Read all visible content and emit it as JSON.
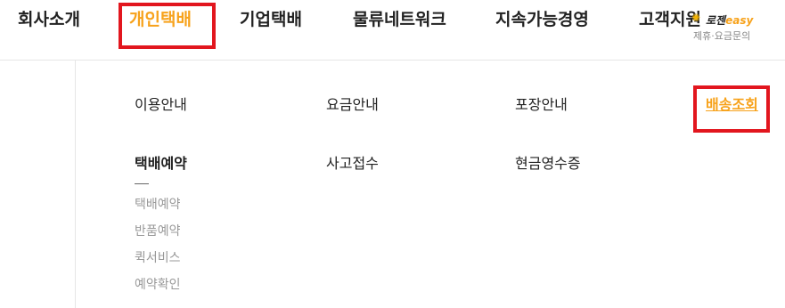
{
  "topnav": {
    "items": [
      {
        "label": "회사소개"
      },
      {
        "label": "개인택배"
      },
      {
        "label": "기업택배"
      },
      {
        "label": "물류네트워크"
      },
      {
        "label": "지속가능경영"
      },
      {
        "label": "고객지원"
      }
    ],
    "accent_color": "#f7a21b",
    "highlight_color": "#e2161e"
  },
  "logo": {
    "brand_kr": "로젠",
    "brand_en": "easy",
    "subtitle": "제휴·요금문의"
  },
  "menu": {
    "row1": [
      "이용안내",
      "요금안내",
      "포장안내",
      "배송조회"
    ],
    "row2": [
      "택배예약",
      "사고접수",
      "현금영수증"
    ]
  },
  "submenu": {
    "items": [
      "택배예약",
      "반품예약",
      "퀵서비스",
      "예약확인"
    ]
  }
}
